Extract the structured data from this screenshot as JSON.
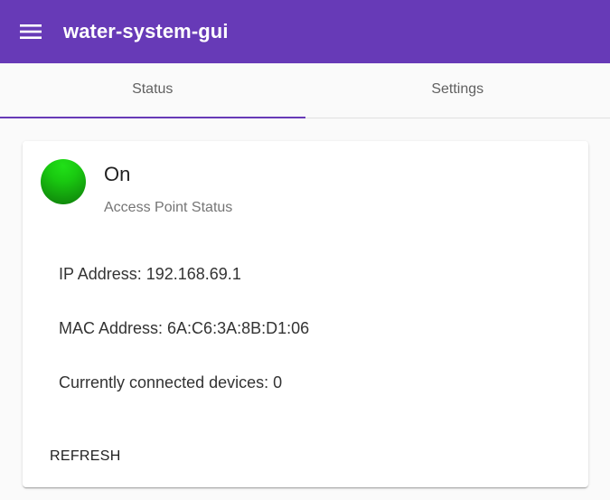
{
  "app": {
    "title": "water-system-gui",
    "primary_color": "#673ab7",
    "menu_icon": "menu-icon"
  },
  "tabs": [
    {
      "label": "Status",
      "active": true
    },
    {
      "label": "Settings",
      "active": false
    }
  ],
  "status_card": {
    "indicator_color": "#19c810",
    "title": "On",
    "subtitle": "Access Point Status",
    "ip_line": "IP Address: 192.168.69.1",
    "mac_line": "MAC Address: 6A:C6:3A:8B:D1:06",
    "devices_line": "Currently connected devices: 0",
    "refresh_label": "REFRESH"
  }
}
